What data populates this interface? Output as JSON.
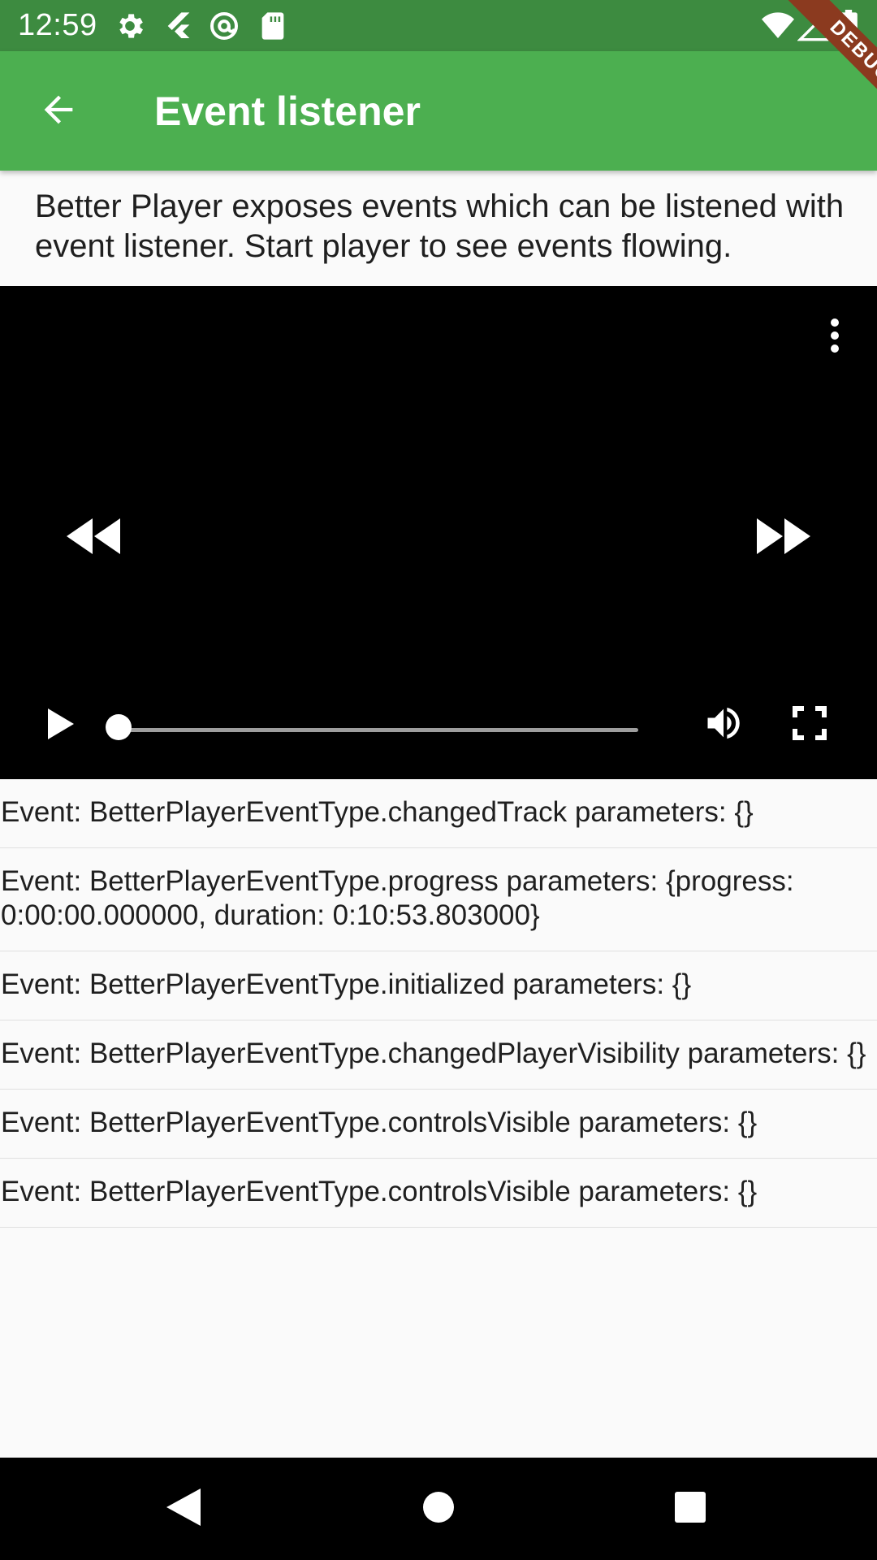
{
  "status_bar": {
    "time": "12:59",
    "left_icons": [
      "settings-icon",
      "flutter-icon",
      "at-sign-icon",
      "sd-card-icon"
    ],
    "right_icons": [
      "wifi-icon",
      "signal-icon",
      "battery-icon"
    ]
  },
  "app_bar": {
    "title": "Event listener",
    "back_icon": "arrow-back-icon",
    "color": "#4caf50"
  },
  "debug_banner": {
    "label": "DEBUG"
  },
  "description": "Better Player exposes events which can be listened with event listener. Start player to see events flowing.",
  "player": {
    "state": "paused",
    "progress_fraction": 0.0,
    "icons": [
      "more-vert-icon",
      "rewind-icon",
      "fast-forward-icon",
      "play-icon",
      "volume-icon",
      "fullscreen-icon"
    ]
  },
  "events": [
    "Event: BetterPlayerEventType.changedTrack parameters: {}",
    "Event: BetterPlayerEventType.progress parameters: {progress: 0:00:00.000000, duration: 0:10:53.803000}",
    "Event: BetterPlayerEventType.initialized parameters: {}",
    "Event: BetterPlayerEventType.changedPlayerVisibility parameters: {}",
    "Event: BetterPlayerEventType.controlsVisible parameters: {}",
    "Event: BetterPlayerEventType.controlsVisible parameters: {}"
  ],
  "nav_bar": {
    "icons": [
      "nav-back-icon",
      "nav-home-icon",
      "nav-recents-icon"
    ]
  }
}
